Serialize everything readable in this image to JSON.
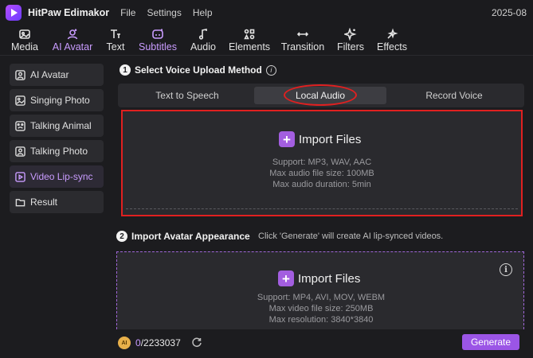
{
  "titlebar": {
    "app_name": "HitPaw Edimakor",
    "menu": [
      "File",
      "Settings",
      "Help"
    ],
    "date": "2025-08"
  },
  "toolbar": {
    "tools": [
      {
        "label": "Media",
        "icon": "media-icon"
      },
      {
        "label": "AI Avatar",
        "icon": "ai-avatar-icon",
        "active": true
      },
      {
        "label": "Text",
        "icon": "text-icon"
      },
      {
        "label": "Subtitles",
        "icon": "subtitles-icon"
      },
      {
        "label": "Audio",
        "icon": "audio-icon"
      },
      {
        "label": "Elements",
        "icon": "elements-icon"
      },
      {
        "label": "Transition",
        "icon": "transition-icon"
      },
      {
        "label": "Filters",
        "icon": "filters-icon"
      },
      {
        "label": "Effects",
        "icon": "effects-icon"
      }
    ]
  },
  "sidebar": {
    "items": [
      {
        "label": "AI Avatar",
        "icon": "avatar-icon"
      },
      {
        "label": "Singing Photo",
        "icon": "photo-icon"
      },
      {
        "label": "Talking Animal",
        "icon": "animal-icon"
      },
      {
        "label": "Talking Photo",
        "icon": "photo-icon"
      },
      {
        "label": "Video Lip-sync",
        "icon": "video-icon",
        "active": true
      },
      {
        "label": "Result",
        "icon": "folder-icon"
      }
    ]
  },
  "step1": {
    "number": "1",
    "title": "Select Voice Upload Method",
    "tabs": [
      "Text to Speech",
      "Local Audio",
      "Record Voice"
    ],
    "active_tab": "Local Audio",
    "import_label": "Import Files",
    "support_lines": [
      "Support: MP3, WAV, AAC",
      "Max audio file size: 100MB",
      "Max audio duration: 5min"
    ]
  },
  "step2": {
    "number": "2",
    "title": "Import Avatar Appearance",
    "hint": "Click 'Generate' will create AI lip-synced videos.",
    "import_label": "Import Files",
    "support_lines": [
      "Support: MP4, AVI, MOV, WEBM",
      "Max video file size: 250MB",
      "Max resolution: 3840*3840"
    ]
  },
  "footer": {
    "coin_label": "AI",
    "credits_used": "0",
    "credits_total": "/2233037",
    "generate_label": "Generate"
  },
  "colors": {
    "accent": "#9b55e6",
    "highlight_red": "#e02020",
    "active_text": "#c99cff"
  }
}
